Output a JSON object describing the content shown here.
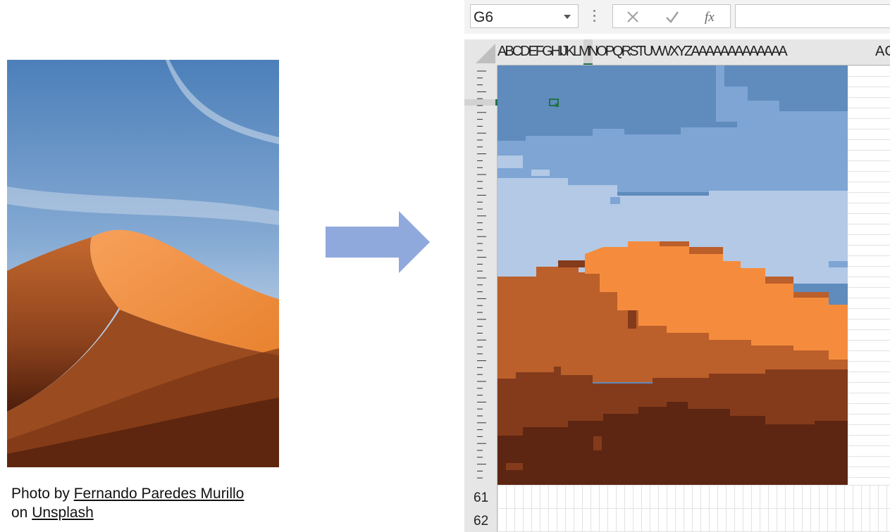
{
  "credit": {
    "prefix": "Photo by ",
    "author": "Fernando Paredes Murillo",
    "middle": "on ",
    "site": "Unsplash"
  },
  "excel": {
    "name_box_value": "G6",
    "formula_value": "",
    "buttons": {
      "cancel_icon": "cross-icon",
      "enter_icon": "checkmark-icon",
      "function_icon": "fx-icon"
    },
    "column_letters": "ABCDEFGHIJKLMNOPQRSTUVWXYZAAAAAAAAAAAAA",
    "column_letters_far": "AC",
    "visible_row_numbers": [
      "61",
      "62"
    ],
    "selected_cell": "G6"
  },
  "palette": {
    "sky_dark": "#5f8bbd",
    "sky_mid": "#7ea5d3",
    "sky_light": "#b3c9e6",
    "sand_light": "#f58c3d",
    "sand_mid": "#bb5f2b",
    "sand_dark": "#843b1b",
    "sand_darkest": "#5d2612",
    "accent_green": "#217346",
    "arrow_blue": "#8fa9dc"
  }
}
